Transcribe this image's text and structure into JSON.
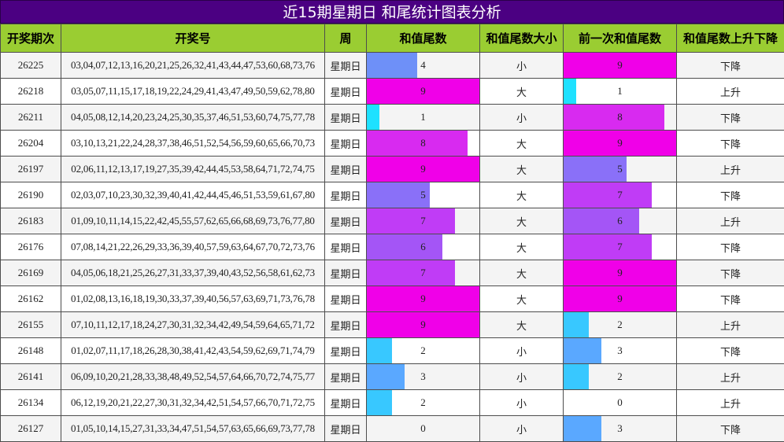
{
  "title": "近15期星期日 和尾统计图表分析",
  "headers": [
    "开奖期次",
    "开奖号",
    "周",
    "和值尾数",
    "和值尾数大小",
    "前一次和值尾数",
    "和值尾数上升下降"
  ],
  "bar_colors": {
    "0": "#ffffff",
    "1": "#1ee1ff",
    "2": "#38c8ff",
    "3": "#5aa8ff",
    "4": "#6e90f8",
    "5": "#8a70f8",
    "6": "#a455f6",
    "7": "#c03cf6",
    "8": "#d82af0",
    "9": "#f000e8"
  },
  "rows": [
    {
      "issue": "26225",
      "numbers": "03,04,07,12,13,16,20,21,25,26,32,41,43,44,47,53,60,68,73,76",
      "week": "星期日",
      "tail": 4,
      "size": "小",
      "prev_tail": 9,
      "trend": "下降"
    },
    {
      "issue": "26218",
      "numbers": "03,05,07,11,15,17,18,19,22,24,29,41,43,47,49,50,59,62,78,80",
      "week": "星期日",
      "tail": 9,
      "size": "大",
      "prev_tail": 1,
      "trend": "上升"
    },
    {
      "issue": "26211",
      "numbers": "04,05,08,12,14,20,23,24,25,30,35,37,46,51,53,60,74,75,77,78",
      "week": "星期日",
      "tail": 1,
      "size": "小",
      "prev_tail": 8,
      "trend": "下降"
    },
    {
      "issue": "26204",
      "numbers": "03,10,13,21,22,24,28,37,38,46,51,52,54,56,59,60,65,66,70,73",
      "week": "星期日",
      "tail": 8,
      "size": "大",
      "prev_tail": 9,
      "trend": "下降"
    },
    {
      "issue": "26197",
      "numbers": "02,06,11,12,13,17,19,27,35,39,42,44,45,53,58,64,71,72,74,75",
      "week": "星期日",
      "tail": 9,
      "size": "大",
      "prev_tail": 5,
      "trend": "上升"
    },
    {
      "issue": "26190",
      "numbers": "02,03,07,10,23,30,32,39,40,41,42,44,45,46,51,53,59,61,67,80",
      "week": "星期日",
      "tail": 5,
      "size": "大",
      "prev_tail": 7,
      "trend": "下降"
    },
    {
      "issue": "26183",
      "numbers": "01,09,10,11,14,15,22,42,45,55,57,62,65,66,68,69,73,76,77,80",
      "week": "星期日",
      "tail": 7,
      "size": "大",
      "prev_tail": 6,
      "trend": "上升"
    },
    {
      "issue": "26176",
      "numbers": "07,08,14,21,22,26,29,33,36,39,40,57,59,63,64,67,70,72,73,76",
      "week": "星期日",
      "tail": 6,
      "size": "大",
      "prev_tail": 7,
      "trend": "下降"
    },
    {
      "issue": "26169",
      "numbers": "04,05,06,18,21,25,26,27,31,33,37,39,40,43,52,56,58,61,62,73",
      "week": "星期日",
      "tail": 7,
      "size": "大",
      "prev_tail": 9,
      "trend": "下降"
    },
    {
      "issue": "26162",
      "numbers": "01,02,08,13,16,18,19,30,33,37,39,40,56,57,63,69,71,73,76,78",
      "week": "星期日",
      "tail": 9,
      "size": "大",
      "prev_tail": 9,
      "trend": "下降"
    },
    {
      "issue": "26155",
      "numbers": "07,10,11,12,17,18,24,27,30,31,32,34,42,49,54,59,64,65,71,72",
      "week": "星期日",
      "tail": 9,
      "size": "大",
      "prev_tail": 2,
      "trend": "上升"
    },
    {
      "issue": "26148",
      "numbers": "01,02,07,11,17,18,26,28,30,38,41,42,43,54,59,62,69,71,74,79",
      "week": "星期日",
      "tail": 2,
      "size": "小",
      "prev_tail": 3,
      "trend": "下降"
    },
    {
      "issue": "26141",
      "numbers": "06,09,10,20,21,28,33,38,48,49,52,54,57,64,66,70,72,74,75,77",
      "week": "星期日",
      "tail": 3,
      "size": "小",
      "prev_tail": 2,
      "trend": "上升"
    },
    {
      "issue": "26134",
      "numbers": "06,12,19,20,21,22,27,30,31,32,34,42,51,54,57,66,70,71,72,75",
      "week": "星期日",
      "tail": 2,
      "size": "小",
      "prev_tail": 0,
      "trend": "上升"
    },
    {
      "issue": "26127",
      "numbers": "01,05,10,14,15,27,31,33,34,47,51,54,57,63,65,66,69,73,77,78",
      "week": "星期日",
      "tail": 0,
      "size": "小",
      "prev_tail": 3,
      "trend": "下降"
    }
  ]
}
